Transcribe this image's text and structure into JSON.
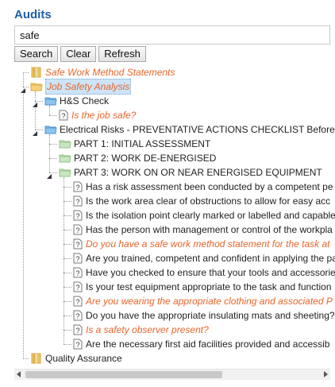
{
  "title": "Audits",
  "search": {
    "value": "safe"
  },
  "buttons": {
    "search": "Search",
    "clear": "Clear",
    "refresh": "Refresh"
  },
  "tree": [
    {
      "label": "Safe Work Method Statements",
      "type": "folder-closed",
      "level": 1,
      "style": "orange"
    },
    {
      "label": "Job Safety Analysis",
      "type": "folder-open-yellow",
      "level": 1,
      "style": "orange",
      "selected": true,
      "toggle": "expanded"
    },
    {
      "label": "H&S Check",
      "type": "folder-blue",
      "level": 2,
      "style": "normal",
      "toggle": "expanded"
    },
    {
      "label": "Is the job safe?",
      "type": "question",
      "level": 3,
      "style": "orange"
    },
    {
      "label": "Electrical Risks - PREVENTATIVE ACTIONS CHECKLIST Before Wo",
      "type": "folder-blue",
      "level": 2,
      "style": "normal",
      "toggle": "expanded"
    },
    {
      "label": "PART 1: INITIAL ASSESSMENT",
      "type": "folder-green",
      "level": 3,
      "style": "normal"
    },
    {
      "label": "PART 2: WORK DE-ENERGISED",
      "type": "folder-green",
      "level": 3,
      "style": "normal"
    },
    {
      "label": "PART 3: WORK ON OR NEAR ENERGISED EQUIPMENT",
      "type": "folder-green",
      "level": 3,
      "style": "normal",
      "toggle": "expanded"
    },
    {
      "label": "Has a risk assessment been conducted by a competent pe",
      "type": "question",
      "level": 4,
      "style": "normal"
    },
    {
      "label": "Is the work area clear of obstructions to allow for easy acc",
      "type": "question",
      "level": 4,
      "style": "normal"
    },
    {
      "label": "Is the isolation point clearly marked or labelled and capable",
      "type": "question",
      "level": 4,
      "style": "normal"
    },
    {
      "label": "Has the person with management or control of the workpla",
      "type": "question",
      "level": 4,
      "style": "normal"
    },
    {
      "label": "Do you have a safe work method statement for the task at",
      "type": "question",
      "level": 4,
      "style": "orange"
    },
    {
      "label": "Are you trained, competent and confident in applying the pa",
      "type": "question",
      "level": 4,
      "style": "normal"
    },
    {
      "label": "Have you checked to ensure that your tools and accessorie",
      "type": "question",
      "level": 4,
      "style": "normal"
    },
    {
      "label": "Is your test equipment appropriate to the task and function",
      "type": "question",
      "level": 4,
      "style": "normal"
    },
    {
      "label": "Are you wearing the appropriate clothing and associated P",
      "type": "question",
      "level": 4,
      "style": "orange"
    },
    {
      "label": "Do you have the appropriate insulating mats and sheeting?",
      "type": "question",
      "level": 4,
      "style": "normal"
    },
    {
      "label": "Is a safety observer present?",
      "type": "question",
      "level": 4,
      "style": "orange"
    },
    {
      "label": "Are the necessary first aid facilities provided and accessib",
      "type": "question",
      "level": 4,
      "style": "normal"
    },
    {
      "label": "Quality Assurance",
      "type": "folder-closed",
      "level": 1,
      "style": "normal"
    }
  ],
  "colors": {
    "title": "#1f5fa6",
    "highlight": "#e8652a",
    "selected_bg": "#cde4f8"
  }
}
